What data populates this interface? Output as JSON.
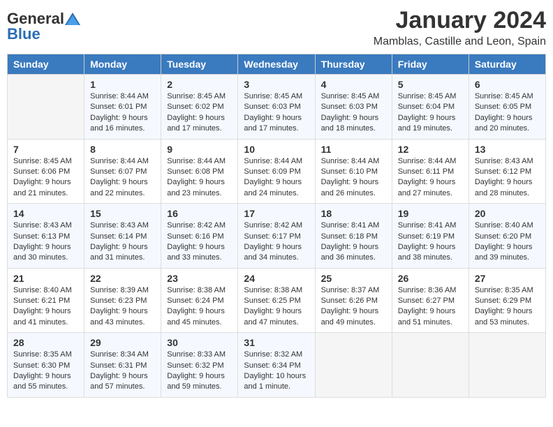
{
  "header": {
    "logo_general": "General",
    "logo_blue": "Blue",
    "month": "January 2024",
    "location": "Mamblas, Castille and Leon, Spain"
  },
  "weekdays": [
    "Sunday",
    "Monday",
    "Tuesday",
    "Wednesday",
    "Thursday",
    "Friday",
    "Saturday"
  ],
  "weeks": [
    [
      {
        "day": "",
        "sunrise": "",
        "sunset": "",
        "daylight": "",
        "empty": true
      },
      {
        "day": "1",
        "sunrise": "Sunrise: 8:44 AM",
        "sunset": "Sunset: 6:01 PM",
        "daylight": "Daylight: 9 hours and 16 minutes."
      },
      {
        "day": "2",
        "sunrise": "Sunrise: 8:45 AM",
        "sunset": "Sunset: 6:02 PM",
        "daylight": "Daylight: 9 hours and 17 minutes."
      },
      {
        "day": "3",
        "sunrise": "Sunrise: 8:45 AM",
        "sunset": "Sunset: 6:03 PM",
        "daylight": "Daylight: 9 hours and 17 minutes."
      },
      {
        "day": "4",
        "sunrise": "Sunrise: 8:45 AM",
        "sunset": "Sunset: 6:03 PM",
        "daylight": "Daylight: 9 hours and 18 minutes."
      },
      {
        "day": "5",
        "sunrise": "Sunrise: 8:45 AM",
        "sunset": "Sunset: 6:04 PM",
        "daylight": "Daylight: 9 hours and 19 minutes."
      },
      {
        "day": "6",
        "sunrise": "Sunrise: 8:45 AM",
        "sunset": "Sunset: 6:05 PM",
        "daylight": "Daylight: 9 hours and 20 minutes."
      }
    ],
    [
      {
        "day": "7",
        "sunrise": "Sunrise: 8:45 AM",
        "sunset": "Sunset: 6:06 PM",
        "daylight": "Daylight: 9 hours and 21 minutes."
      },
      {
        "day": "8",
        "sunrise": "Sunrise: 8:44 AM",
        "sunset": "Sunset: 6:07 PM",
        "daylight": "Daylight: 9 hours and 22 minutes."
      },
      {
        "day": "9",
        "sunrise": "Sunrise: 8:44 AM",
        "sunset": "Sunset: 6:08 PM",
        "daylight": "Daylight: 9 hours and 23 minutes."
      },
      {
        "day": "10",
        "sunrise": "Sunrise: 8:44 AM",
        "sunset": "Sunset: 6:09 PM",
        "daylight": "Daylight: 9 hours and 24 minutes."
      },
      {
        "day": "11",
        "sunrise": "Sunrise: 8:44 AM",
        "sunset": "Sunset: 6:10 PM",
        "daylight": "Daylight: 9 hours and 26 minutes."
      },
      {
        "day": "12",
        "sunrise": "Sunrise: 8:44 AM",
        "sunset": "Sunset: 6:11 PM",
        "daylight": "Daylight: 9 hours and 27 minutes."
      },
      {
        "day": "13",
        "sunrise": "Sunrise: 8:43 AM",
        "sunset": "Sunset: 6:12 PM",
        "daylight": "Daylight: 9 hours and 28 minutes."
      }
    ],
    [
      {
        "day": "14",
        "sunrise": "Sunrise: 8:43 AM",
        "sunset": "Sunset: 6:13 PM",
        "daylight": "Daylight: 9 hours and 30 minutes."
      },
      {
        "day": "15",
        "sunrise": "Sunrise: 8:43 AM",
        "sunset": "Sunset: 6:14 PM",
        "daylight": "Daylight: 9 hours and 31 minutes."
      },
      {
        "day": "16",
        "sunrise": "Sunrise: 8:42 AM",
        "sunset": "Sunset: 6:16 PM",
        "daylight": "Daylight: 9 hours and 33 minutes."
      },
      {
        "day": "17",
        "sunrise": "Sunrise: 8:42 AM",
        "sunset": "Sunset: 6:17 PM",
        "daylight": "Daylight: 9 hours and 34 minutes."
      },
      {
        "day": "18",
        "sunrise": "Sunrise: 8:41 AM",
        "sunset": "Sunset: 6:18 PM",
        "daylight": "Daylight: 9 hours and 36 minutes."
      },
      {
        "day": "19",
        "sunrise": "Sunrise: 8:41 AM",
        "sunset": "Sunset: 6:19 PM",
        "daylight": "Daylight: 9 hours and 38 minutes."
      },
      {
        "day": "20",
        "sunrise": "Sunrise: 8:40 AM",
        "sunset": "Sunset: 6:20 PM",
        "daylight": "Daylight: 9 hours and 39 minutes."
      }
    ],
    [
      {
        "day": "21",
        "sunrise": "Sunrise: 8:40 AM",
        "sunset": "Sunset: 6:21 PM",
        "daylight": "Daylight: 9 hours and 41 minutes."
      },
      {
        "day": "22",
        "sunrise": "Sunrise: 8:39 AM",
        "sunset": "Sunset: 6:23 PM",
        "daylight": "Daylight: 9 hours and 43 minutes."
      },
      {
        "day": "23",
        "sunrise": "Sunrise: 8:38 AM",
        "sunset": "Sunset: 6:24 PM",
        "daylight": "Daylight: 9 hours and 45 minutes."
      },
      {
        "day": "24",
        "sunrise": "Sunrise: 8:38 AM",
        "sunset": "Sunset: 6:25 PM",
        "daylight": "Daylight: 9 hours and 47 minutes."
      },
      {
        "day": "25",
        "sunrise": "Sunrise: 8:37 AM",
        "sunset": "Sunset: 6:26 PM",
        "daylight": "Daylight: 9 hours and 49 minutes."
      },
      {
        "day": "26",
        "sunrise": "Sunrise: 8:36 AM",
        "sunset": "Sunset: 6:27 PM",
        "daylight": "Daylight: 9 hours and 51 minutes."
      },
      {
        "day": "27",
        "sunrise": "Sunrise: 8:35 AM",
        "sunset": "Sunset: 6:29 PM",
        "daylight": "Daylight: 9 hours and 53 minutes."
      }
    ],
    [
      {
        "day": "28",
        "sunrise": "Sunrise: 8:35 AM",
        "sunset": "Sunset: 6:30 PM",
        "daylight": "Daylight: 9 hours and 55 minutes."
      },
      {
        "day": "29",
        "sunrise": "Sunrise: 8:34 AM",
        "sunset": "Sunset: 6:31 PM",
        "daylight": "Daylight: 9 hours and 57 minutes."
      },
      {
        "day": "30",
        "sunrise": "Sunrise: 8:33 AM",
        "sunset": "Sunset: 6:32 PM",
        "daylight": "Daylight: 9 hours and 59 minutes."
      },
      {
        "day": "31",
        "sunrise": "Sunrise: 8:32 AM",
        "sunset": "Sunset: 6:34 PM",
        "daylight": "Daylight: 10 hours and 1 minute."
      },
      {
        "day": "",
        "sunrise": "",
        "sunset": "",
        "daylight": "",
        "empty": true
      },
      {
        "day": "",
        "sunrise": "",
        "sunset": "",
        "daylight": "",
        "empty": true
      },
      {
        "day": "",
        "sunrise": "",
        "sunset": "",
        "daylight": "",
        "empty": true
      }
    ]
  ]
}
